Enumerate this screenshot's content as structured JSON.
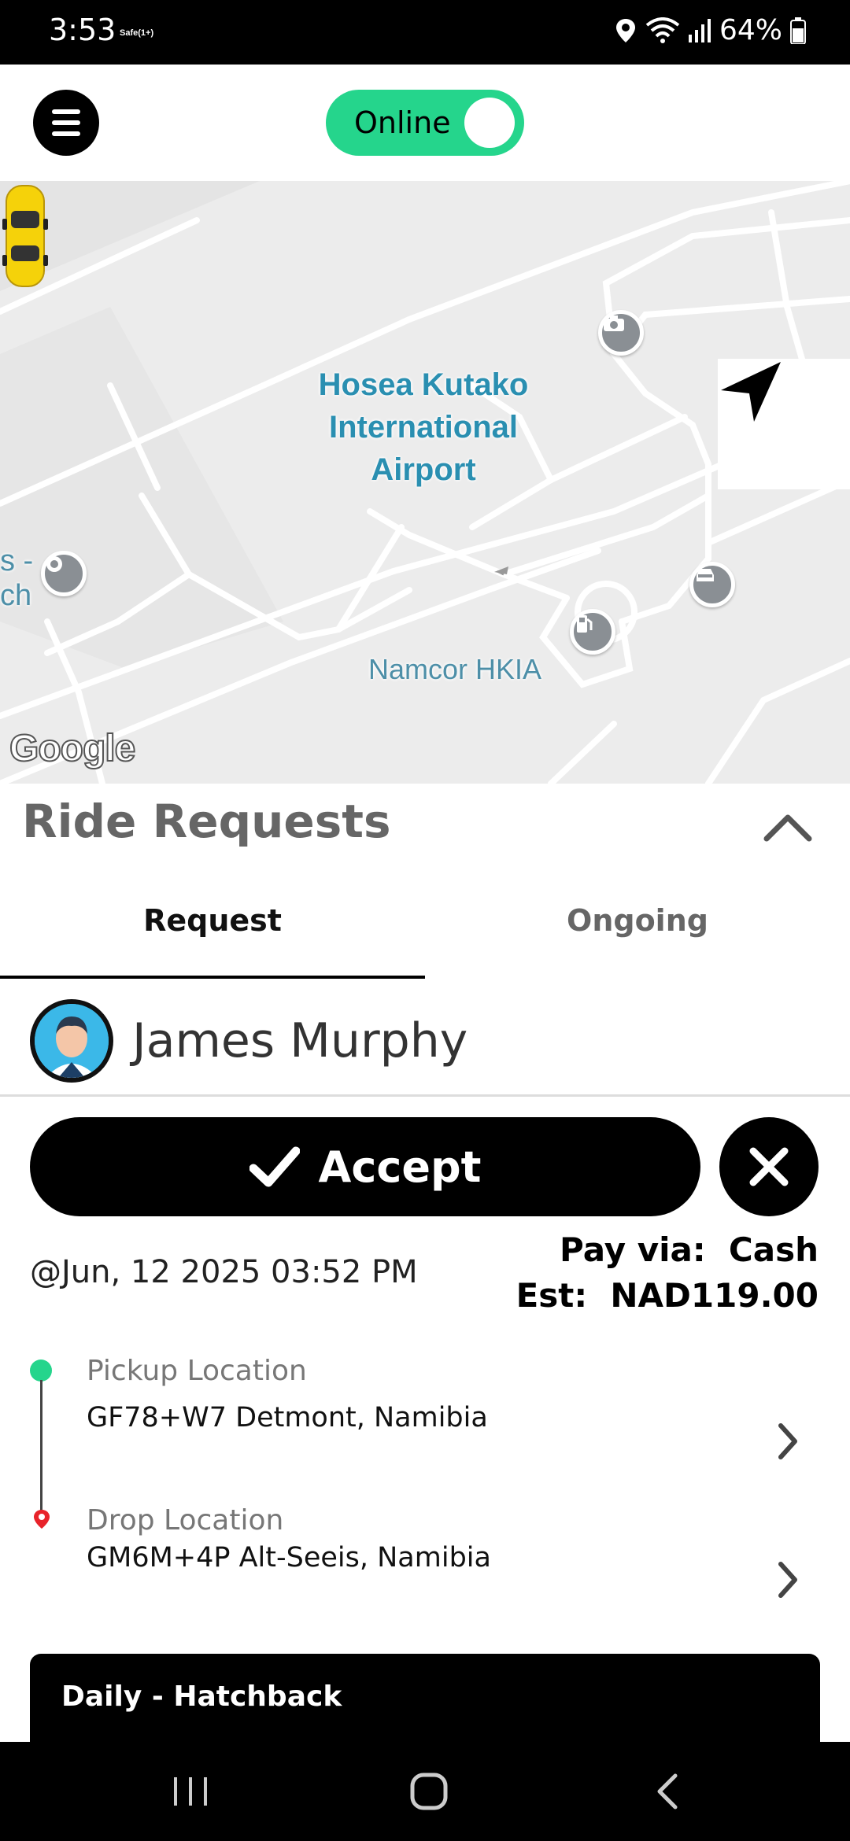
{
  "status_bar": {
    "time": "3:53",
    "carrier": "Safe(1+)",
    "battery": "64%"
  },
  "header": {
    "status_toggle_label": "Online",
    "status_toggle_on": true
  },
  "map": {
    "airport_label_line1": "Hosea Kutako",
    "airport_label_line2": "International",
    "airport_label_line3": "Airport",
    "fuel_label": "Namcor HKIA",
    "left_label_1": "s -",
    "left_label_2": "ch",
    "provider": "Google",
    "icons": [
      "camera-icon",
      "location-pin-icon",
      "car-rental-icon",
      "fuel-icon",
      "car-icon",
      "navigation-arrow-icon"
    ]
  },
  "ride_requests": {
    "title": "Ride Requests",
    "tabs": [
      {
        "label": "Request",
        "active": true
      },
      {
        "label": "Ongoing",
        "active": false
      }
    ],
    "rider_name": "James Murphy",
    "accept_label": "Accept",
    "datetime": "@Jun, 12 2025 03:52 PM",
    "pay_via_label": "Pay via:",
    "pay_via_value": "Cash",
    "est_label": "Est:",
    "est_value": "NAD119.00",
    "pickup": {
      "title": "Pickup Location",
      "address": "GF78+W7 Detmont, Namibia"
    },
    "drop": {
      "title": "Drop Location",
      "address": "GM6M+4P Alt-Seeis, Namibia"
    },
    "vehicle": "Daily - Hatchback"
  },
  "colors": {
    "online_green": "#25d58c",
    "map_label_blue": "#2a8fb1",
    "drop_red": "#e8232a"
  }
}
